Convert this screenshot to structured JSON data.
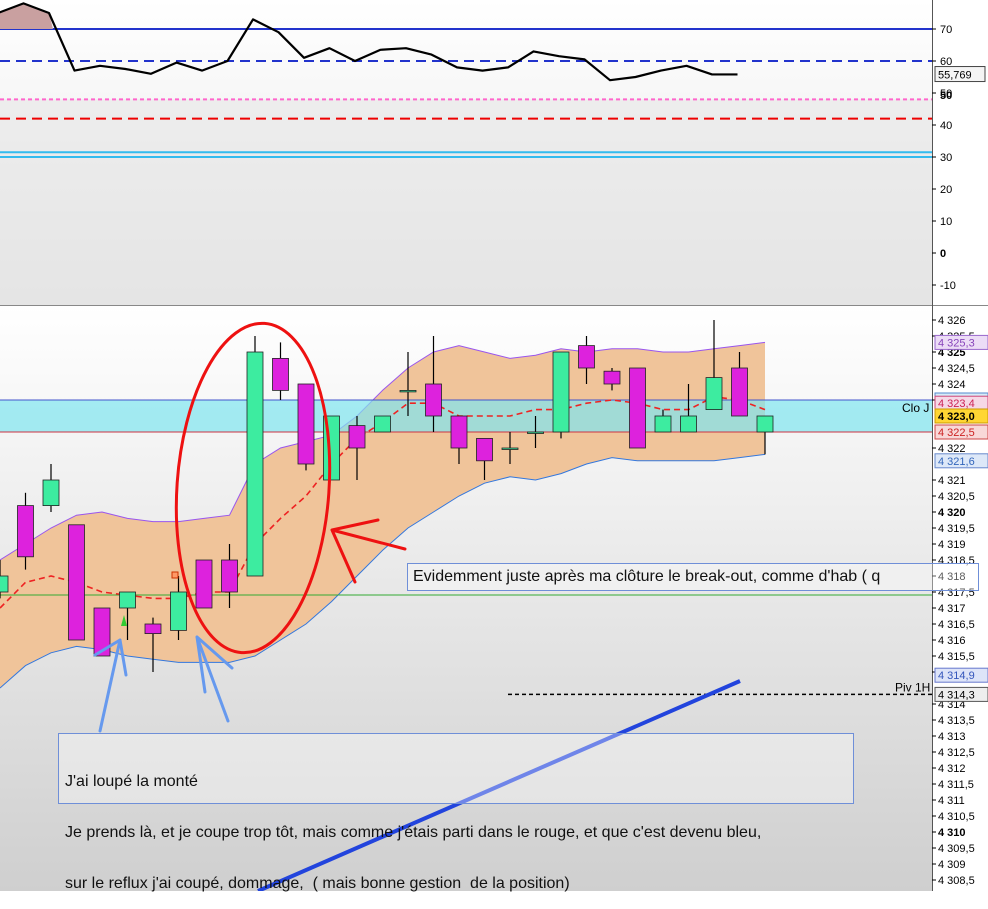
{
  "rsi_panel": {
    "ticks": [
      "70",
      "60",
      "50",
      "40",
      "30",
      "20",
      "10",
      "0",
      "-10"
    ],
    "value_label": "55,769",
    "levels": [
      {
        "value": 70,
        "color": "#2233cc",
        "style": "solid"
      },
      {
        "value": 60,
        "color": "#2233cc",
        "style": "dashed"
      },
      {
        "value": 48,
        "color": "#ff66cc",
        "style": "dotted"
      },
      {
        "value": 42,
        "color": "#ee0000",
        "style": "dashed"
      },
      {
        "value": 31.5,
        "color": "#33bbee",
        "style": "solid"
      },
      {
        "value": 30,
        "color": "#33bbee",
        "style": "solid"
      }
    ],
    "line": [
      75,
      78,
      75,
      57,
      58.5,
      57.5,
      56,
      59.5,
      57,
      60,
      73,
      69,
      61,
      64,
      60,
      63.5,
      64,
      62,
      58,
      57,
      58,
      63,
      61.5,
      60.5,
      54,
      55,
      57,
      58.5,
      55.8,
      55.8
    ]
  },
  "price_panel": {
    "tick_labels": [
      {
        "v": 4326,
        "t": "4 326",
        "b": false
      },
      {
        "v": 4325.5,
        "t": "4 325,5",
        "b": false
      },
      {
        "v": 4325,
        "t": "4 325",
        "b": true
      },
      {
        "v": 4324.5,
        "t": "4 324,5",
        "b": false
      },
      {
        "v": 4324,
        "t": "4 324",
        "b": false
      },
      {
        "v": 4323.5,
        "t": "4 323,5",
        "b": false
      },
      {
        "v": 4322,
        "t": "4 322",
        "b": false
      },
      {
        "v": 4321,
        "t": "4 321",
        "b": false
      },
      {
        "v": 4320.5,
        "t": "4 320,5",
        "b": false
      },
      {
        "v": 4320,
        "t": "4 320",
        "b": true
      },
      {
        "v": 4319.5,
        "t": "4 319,5",
        "b": false
      },
      {
        "v": 4319,
        "t": "4 319",
        "b": false
      },
      {
        "v": 4318.5,
        "t": "4 318,5",
        "b": false
      },
      {
        "v": 4318,
        "t": "4 318",
        "b": false
      },
      {
        "v": 4317.5,
        "t": "4 317,5",
        "b": false
      },
      {
        "v": 4317,
        "t": "4 317",
        "b": false
      },
      {
        "v": 4316.5,
        "t": "4 316,5",
        "b": false
      },
      {
        "v": 4316,
        "t": "4 316",
        "b": false
      },
      {
        "v": 4315.5,
        "t": "4 315,5",
        "b": false
      },
      {
        "v": 4315,
        "t": "4 315",
        "b": false
      },
      {
        "v": 4314,
        "t": "4 314",
        "b": false
      },
      {
        "v": 4313.5,
        "t": "4 313,5",
        "b": false
      },
      {
        "v": 4313,
        "t": "4 313",
        "b": false
      },
      {
        "v": 4312.5,
        "t": "4 312,5",
        "b": false
      },
      {
        "v": 4312,
        "t": "4 312",
        "b": false
      },
      {
        "v": 4311.5,
        "t": "4 311,5",
        "b": false
      },
      {
        "v": 4311,
        "t": "4 311",
        "b": false
      },
      {
        "v": 4310.5,
        "t": "4 310,5",
        "b": false
      },
      {
        "v": 4310,
        "t": "4 310",
        "b": true
      },
      {
        "v": 4309.5,
        "t": "4 309,5",
        "b": false
      },
      {
        "v": 4309,
        "t": "4 309",
        "b": false
      },
      {
        "v": 4308.5,
        "t": "4 308,5",
        "b": false
      }
    ],
    "price_labels": [
      {
        "v": 4325.3,
        "t": "4 325,3",
        "bg": "#ecdcf6",
        "fg": "#8844bb",
        "border": "#9966cc"
      },
      {
        "v": 4323.5,
        "t": "4 323,5",
        "bg": "#d6ecf8",
        "fg": "#2255aa",
        "border": "#5588cc"
      },
      {
        "v": 4323.4,
        "t": "4 323,4",
        "bg": "#f6d8e6",
        "fg": "#cc2255",
        "border": "#cc4477"
      },
      {
        "v": 4323.0,
        "t": "4 323,0",
        "bg": "#ffd633",
        "fg": "#000000",
        "border": "#cc9900"
      },
      {
        "v": 4322.5,
        "t": "4 322,5",
        "bg": "#f8d8d8",
        "fg": "#cc2222",
        "border": "#cc4444"
      },
      {
        "v": 4321.6,
        "t": "4 321,6",
        "bg": "#dde8f8",
        "fg": "#3366bb",
        "border": "#6688cc"
      },
      {
        "v": 4314.9,
        "t": "4 314,9",
        "bg": "#dde4f8",
        "fg": "#3355bb",
        "border": "#6677cc"
      },
      {
        "v": 4314.3,
        "t": "4 314,3",
        "bg": "#eeeeee",
        "fg": "#000000",
        "border": "#555555"
      }
    ],
    "clo_label": "Clo J",
    "piv_label": "Piv 1H",
    "candles": [
      {
        "o": 4317.5,
        "h": 4318.5,
        "l": 4317.3,
        "c": 4318.0
      },
      {
        "o": 4320.2,
        "h": 4320.6,
        "l": 4318.2,
        "c": 4318.6
      },
      {
        "o": 4320.2,
        "h": 4321.5,
        "l": 4320.0,
        "c": 4321.0
      },
      {
        "o": 4319.6,
        "h": 4319.6,
        "l": 4316.0,
        "c": 4316.0
      },
      {
        "o": 4317.0,
        "h": 4317.0,
        "l": 4315.5,
        "c": 4315.5
      },
      {
        "o": 4317.0,
        "h": 4317.0,
        "l": 4316.0,
        "c": 4317.5
      },
      {
        "o": 4316.5,
        "h": 4316.7,
        "l": 4315.0,
        "c": 4316.2
      },
      {
        "o": 4316.3,
        "h": 4318.0,
        "l": 4316.0,
        "c": 4317.5
      },
      {
        "o": 4318.5,
        "h": 4318.5,
        "l": 4317.0,
        "c": 4317.0
      },
      {
        "o": 4318.5,
        "h": 4319.0,
        "l": 4317.0,
        "c": 4317.5
      },
      {
        "o": 4318.0,
        "h": 4325.5,
        "l": 4318.0,
        "c": 4325.0
      },
      {
        "o": 4324.8,
        "h": 4325.3,
        "l": 4323.5,
        "c": 4323.8
      },
      {
        "o": 4324.0,
        "h": 4324.0,
        "l": 4321.3,
        "c": 4321.5
      },
      {
        "o": 4321.0,
        "h": 4323.0,
        "l": 4321.0,
        "c": 4323.0
      },
      {
        "o": 4322.7,
        "h": 4323.0,
        "l": 4321.0,
        "c": 4322.0
      },
      {
        "o": 4322.5,
        "h": 4323.0,
        "l": 4322.5,
        "c": 4323.0
      },
      {
        "o": 4323.8,
        "h": 4325.0,
        "l": 4323.0,
        "c": 4323.8
      },
      {
        "o": 4324.0,
        "h": 4325.5,
        "l": 4322.5,
        "c": 4323.0
      },
      {
        "o": 4323.0,
        "h": 4323.0,
        "l": 4321.5,
        "c": 4322.0
      },
      {
        "o": 4322.3,
        "h": 4322.3,
        "l": 4321.0,
        "c": 4321.6
      },
      {
        "o": 4322.0,
        "h": 4322.5,
        "l": 4321.5,
        "c": 4322.0
      },
      {
        "o": 4322.5,
        "h": 4323.0,
        "l": 4322.0,
        "c": 4322.5
      },
      {
        "o": 4322.5,
        "h": 4325.0,
        "l": 4322.3,
        "c": 4325.0
      },
      {
        "o": 4325.2,
        "h": 4325.5,
        "l": 4324.0,
        "c": 4324.5
      },
      {
        "o": 4324.4,
        "h": 4324.5,
        "l": 4323.8,
        "c": 4324.0
      },
      {
        "o": 4324.5,
        "h": 4324.5,
        "l": 4322.0,
        "c": 4322.0
      },
      {
        "o": 4322.5,
        "h": 4323.2,
        "l": 4322.5,
        "c": 4323.0
      },
      {
        "o": 4322.5,
        "h": 4324.0,
        "l": 4322.5,
        "c": 4323.0
      },
      {
        "o": 4323.2,
        "h": 4326.0,
        "l": 4323.2,
        "c": 4324.2
      },
      {
        "o": 4324.5,
        "h": 4325.0,
        "l": 4323.0,
        "c": 4323.0
      },
      {
        "o": 4322.5,
        "h": 4323.0,
        "l": 4321.8,
        "c": 4323.0
      }
    ],
    "band_upper": [
      4318.5,
      4319.0,
      4319.5,
      4319.9,
      4320.0,
      4319.8,
      4319.7,
      4319.7,
      4319.8,
      4319.9,
      4321.5,
      4322.0,
      4322.2,
      4322.4,
      4323.0,
      4323.8,
      4324.5,
      4325.0,
      4325.2,
      4325.0,
      4324.8,
      4324.9,
      4325.1,
      4325.0,
      4325.1,
      4325.1,
      4325.0,
      4325.0,
      4325.1,
      4325.2,
      4325.3
    ],
    "band_lower": [
      4314.5,
      4315.2,
      4315.6,
      4315.8,
      4315.7,
      4315.5,
      4315.4,
      4315.3,
      4315.3,
      4315.3,
      4315.5,
      4316.0,
      4316.5,
      4317.2,
      4318.0,
      4318.8,
      4319.5,
      4320.0,
      4320.5,
      4320.9,
      4321.1,
      4321.0,
      4321.2,
      4321.5,
      4321.7,
      4321.6,
      4321.6,
      4321.6,
      4321.6,
      4321.7,
      4321.8
    ],
    "moving_avg": [
      4317.0,
      4317.8,
      4318.0,
      4317.8,
      4317.5,
      4317.4,
      4317.3,
      4317.3,
      4317.5,
      4317.5,
      4319.0,
      4319.8,
      4320.5,
      4321.5,
      4322.3,
      4322.8,
      4323.4,
      4323.4,
      4323.0,
      4323.0,
      4323.0,
      4323.2,
      4323.2,
      4323.4,
      4323.5,
      4323.4,
      4323.2,
      4323.2,
      4323.6,
      4323.5,
      4323.2
    ],
    "clo_zone": {
      "from": 4323.5,
      "to": 4322.5
    },
    "piv_value": 4314.3,
    "green_level": 4317.5,
    "blue_trend": {
      "from": 4307.5,
      "to": 4315.0
    },
    "colors": {
      "up": "#3deca0",
      "down": "#dd22dd",
      "band": "#f0c49a"
    }
  },
  "annotations": {
    "note1": "Evidemment juste après ma clôture le break-out, comme d'hab ( q",
    "note2_lines": [
      "J'ai loupé la monté",
      "Je prends là, et je coupe trop tôt, mais comme j'étais parti dans le rouge, et que c'est devenu bleu,",
      "sur le reflux j'ai coupé, dommage,  ( mais bonne gestion  de la position)"
    ]
  }
}
